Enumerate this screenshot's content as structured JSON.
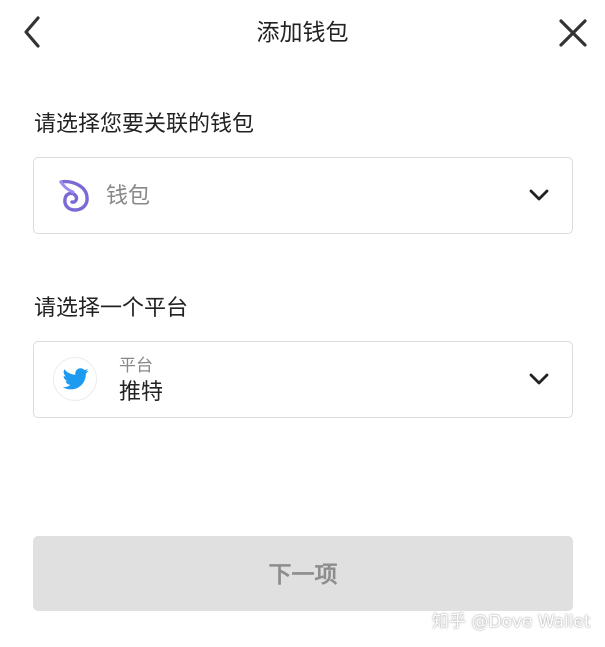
{
  "header": {
    "title": "添加钱包",
    "back_icon": "chevron-left-icon",
    "close_icon": "close-icon"
  },
  "wallet_section": {
    "label": "请选择您要关联的钱包",
    "selected_value": "钱包",
    "icon": "dove-wallet-icon"
  },
  "platform_section": {
    "label": "请选择一个平台",
    "caption": "平台",
    "selected_value": "推特",
    "icon": "twitter-icon"
  },
  "next_button": {
    "label": "下一项",
    "enabled": false
  },
  "watermark": {
    "text": "知乎 @Dove Wallet"
  },
  "colors": {
    "accent_purple": "#7b6ad6",
    "twitter_blue": "#1d9bf0",
    "disabled_button_bg": "#e0e0e0",
    "disabled_button_text": "#8d8d8d",
    "border": "#dcdcdc"
  }
}
